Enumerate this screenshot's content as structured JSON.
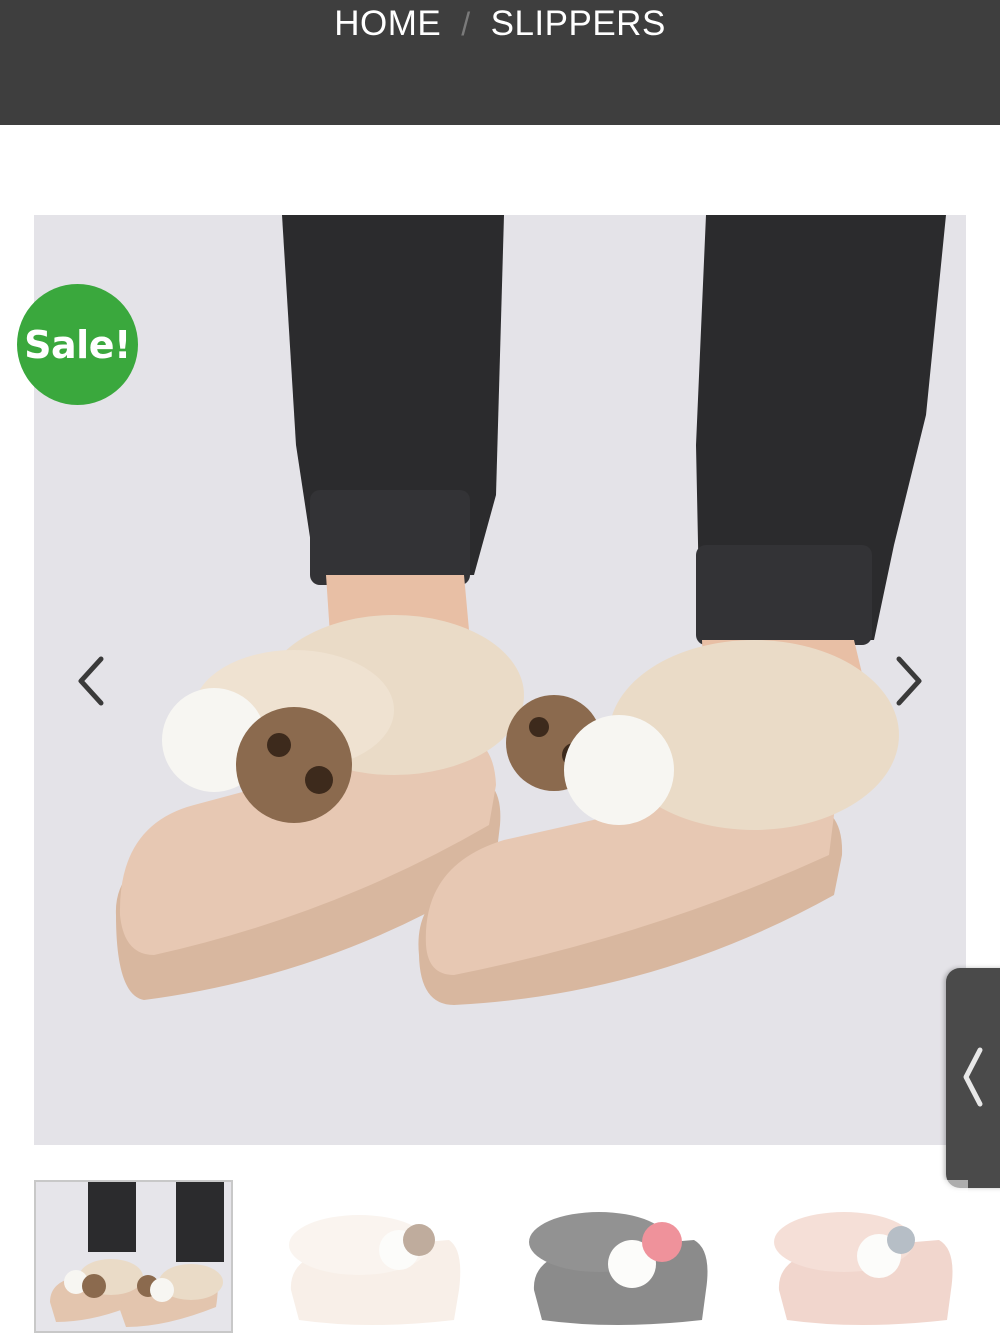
{
  "breadcrumb": {
    "home_label": "HOME",
    "separator": "/",
    "current_label": "SLIPPERS"
  },
  "badge": {
    "label": "Sale!",
    "color": "#3aa83d"
  },
  "gallery": {
    "prev_icon": "chevron-left-icon",
    "next_icon": "chevron-right-icon",
    "main_image": "beige-fur-loafer-slippers-with-pom-poms-on-model",
    "thumbnails": [
      {
        "image": "beige-pom-slippers-on-model",
        "active": true
      },
      {
        "image": "cream-pom-slipper-side",
        "active": false
      },
      {
        "image": "black-pom-slipper-side",
        "active": false
      },
      {
        "image": "pink-pom-slipper-side",
        "active": false
      }
    ]
  },
  "side_tab": {
    "icon": "chevron-left-icon"
  },
  "colors": {
    "header_bg": "#3e3e3e",
    "image_bg": "#e4e3e8"
  }
}
